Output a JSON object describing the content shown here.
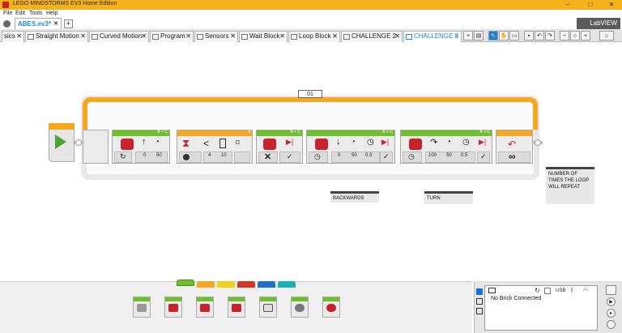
{
  "window": {
    "title": "LEGO MINDSTORMS EV3 Home Edition",
    "minimize": "–",
    "maximize": "□",
    "close": "✕"
  },
  "menu": [
    "File",
    "Edit",
    "Tools",
    "Help"
  ],
  "project": {
    "tab_label": "ABES.ev3*",
    "close": "✕",
    "add": "+",
    "brand": "LabVIEW"
  },
  "program_tabs": [
    {
      "label": "sics"
    },
    {
      "label": "Straight Motion"
    },
    {
      "label": "Curved Motion"
    },
    {
      "label": "Program"
    },
    {
      "label": "Sensors"
    },
    {
      "label": "Wait Block"
    },
    {
      "label": "Loop Block"
    },
    {
      "label": "CHALLENGE 2"
    },
    {
      "label": "CHALLENGE 3"
    }
  ],
  "tab_close": "✕",
  "loop": {
    "id": "01"
  },
  "blocks": [
    {
      "port": "B + C",
      "values": [
        "0",
        "50"
      ]
    },
    {
      "port": "4",
      "values": [
        "4",
        "10"
      ]
    },
    {
      "port": "B + C",
      "values": []
    },
    {
      "port": "B + C",
      "values": [
        "0",
        "50",
        "0.3"
      ]
    },
    {
      "port": "B + C",
      "values": [
        "100",
        "50",
        "0.5"
      ]
    }
  ],
  "comments": {
    "backwards": "BACKWARDS",
    "turn": "TURN",
    "loop_note": "NUMBER OF TIMES THE LOOP WILL REPEAT"
  },
  "hardware": {
    "usb": "USB",
    "status": "No Brick Connected"
  },
  "colors": {
    "accent_orange": "#f5a71f",
    "action_green": "#6ec02a",
    "tab_blue": "#1a8ad4"
  }
}
